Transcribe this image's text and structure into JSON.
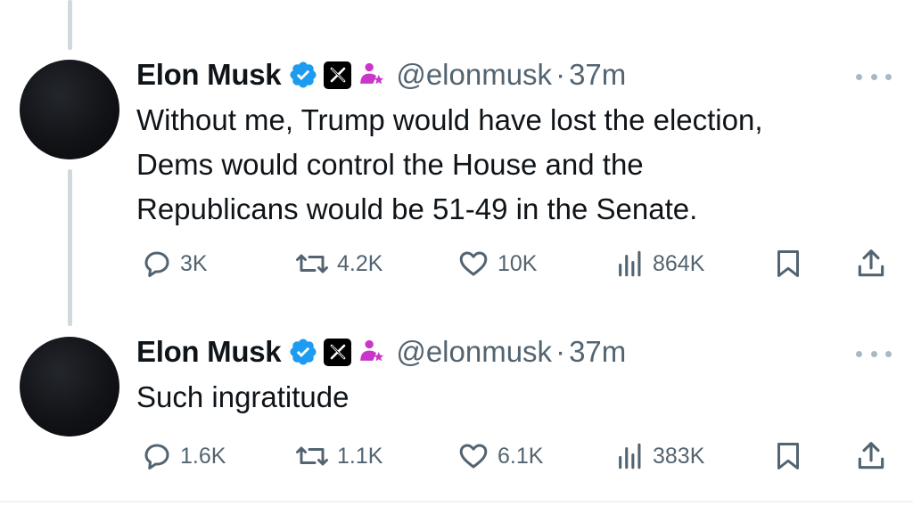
{
  "tweets": [
    {
      "author_name": "Elon Musk",
      "handle": "@elonmusk",
      "separator": "·",
      "time": "37m",
      "text_lines": [
        "Without me, Trump would have lost the election,",
        "Dems would control the House and the",
        "Republicans would be 51-49 in the Senate."
      ],
      "replies": "3K",
      "reposts": "4.2K",
      "likes": "10K",
      "views": "864K"
    },
    {
      "author_name": "Elon Musk",
      "handle": "@elonmusk",
      "separator": "·",
      "time": "37m",
      "text_lines": [
        "Such ingratitude"
      ],
      "replies": "1.6K",
      "reposts": "1.1K",
      "likes": "6.1K",
      "views": "383K"
    }
  ],
  "icons": {
    "verified": "verified-badge-icon",
    "x_badge": "x-logo-icon",
    "affiliation": "government-affiliation-icon",
    "more": "more-options-icon",
    "reply": "reply-icon",
    "repost": "repost-icon",
    "like": "heart-icon",
    "views": "analytics-icon",
    "bookmark": "bookmark-icon",
    "share": "share-icon"
  },
  "colors": {
    "verified_blue": "#1d9bf0",
    "affiliation_magenta": "#c936c9",
    "secondary_text": "#536471",
    "thread_line": "#cfd9de"
  }
}
